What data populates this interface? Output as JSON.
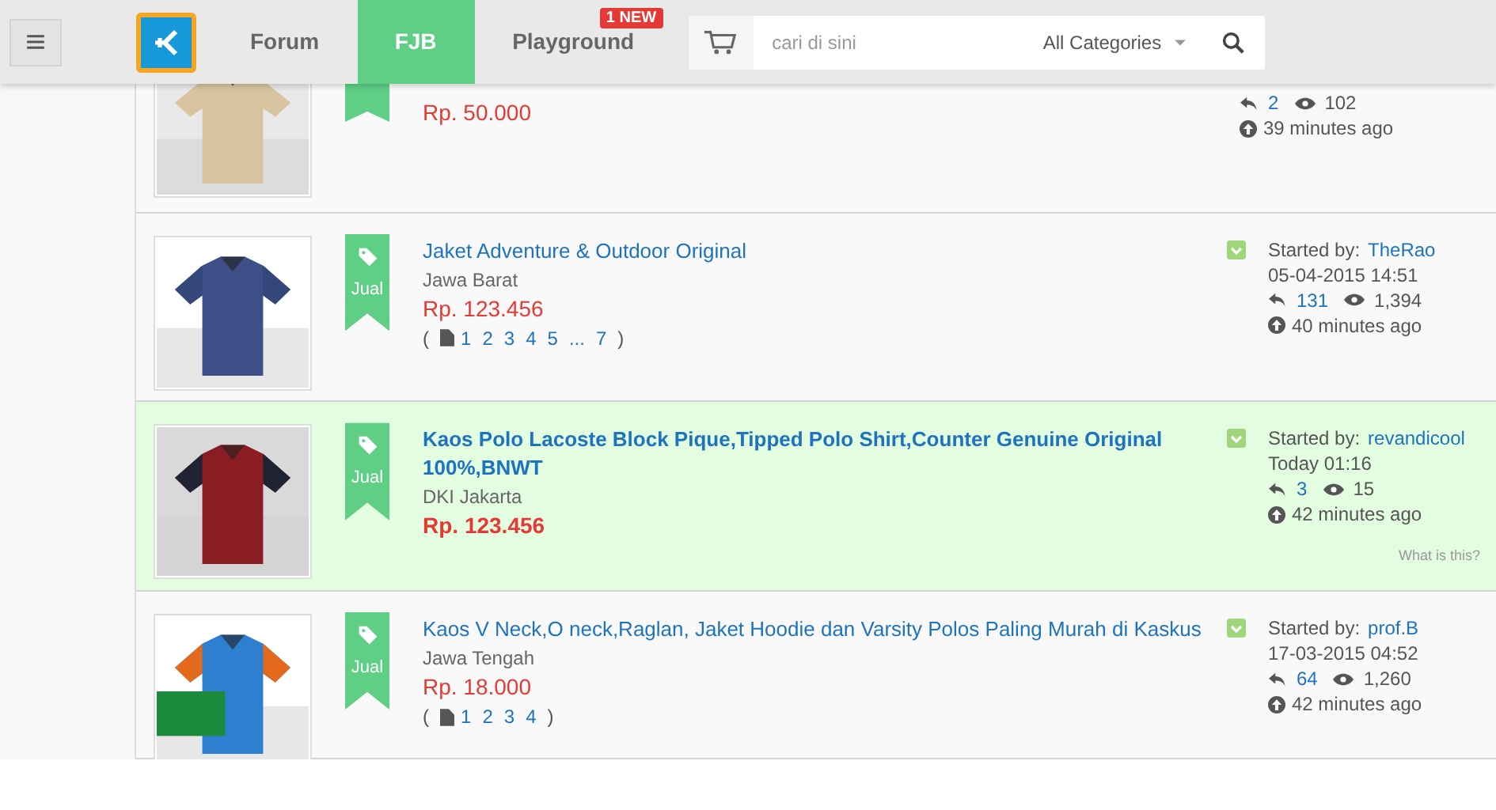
{
  "nav": [
    {
      "label": "Forum",
      "selected": false
    },
    {
      "label": "FJB",
      "selected": true
    },
    {
      "label": "Playground",
      "selected": false,
      "badge": "1 NEW"
    }
  ],
  "search": {
    "placeholder": "cari di sini",
    "category": "All Categories"
  },
  "threads": [
    {
      "kind": "partial",
      "featured": false,
      "price": "Rp. 50.000",
      "replies": "2",
      "views": "102",
      "updated": "39 minutes ago"
    },
    {
      "kind": "full",
      "featured": false,
      "ribbon": "Jual",
      "title": "Jaket Adventure & Outdoor Original",
      "location": "Jawa Barat",
      "price": "Rp. 123.456",
      "paren_open": "(",
      "pages": [
        "1",
        "2",
        "3",
        "4",
        "5",
        "...",
        "7"
      ],
      "paren_close": ")",
      "started_label": "Started by:",
      "starter": "TheRao",
      "date": "05-04-2015 14:51",
      "replies": "131",
      "views": "1,394",
      "updated": "40 minutes ago"
    },
    {
      "kind": "full",
      "featured": true,
      "ribbon": "Jual",
      "title": "Kaos Polo Lacoste Block Pique,Tipped Polo Shirt,Counter Genuine Original 100%,BNWT",
      "location": "DKI Jakarta",
      "price": "Rp. 123.456",
      "started_label": "Started by:",
      "starter": "revandicool",
      "date": "Today 01:16",
      "replies": "3",
      "views": "15",
      "updated": "42 minutes ago",
      "note": "What is this?"
    },
    {
      "kind": "full",
      "featured": false,
      "ribbon": "Jual",
      "title": "Kaos V Neck,O neck,Raglan, Jaket Hoodie dan Varsity Polos Paling Murah di Kaskus",
      "location": "Jawa Tengah",
      "price": "Rp. 18.000",
      "paren_open": "(",
      "pages": [
        "1",
        "2",
        "3",
        "4"
      ],
      "paren_close": ")",
      "started_label": "Started by:",
      "starter": "prof.B",
      "date": "17-03-2015 04:52",
      "replies": "64",
      "views": "1,260",
      "updated": "42 minutes ago"
    }
  ]
}
